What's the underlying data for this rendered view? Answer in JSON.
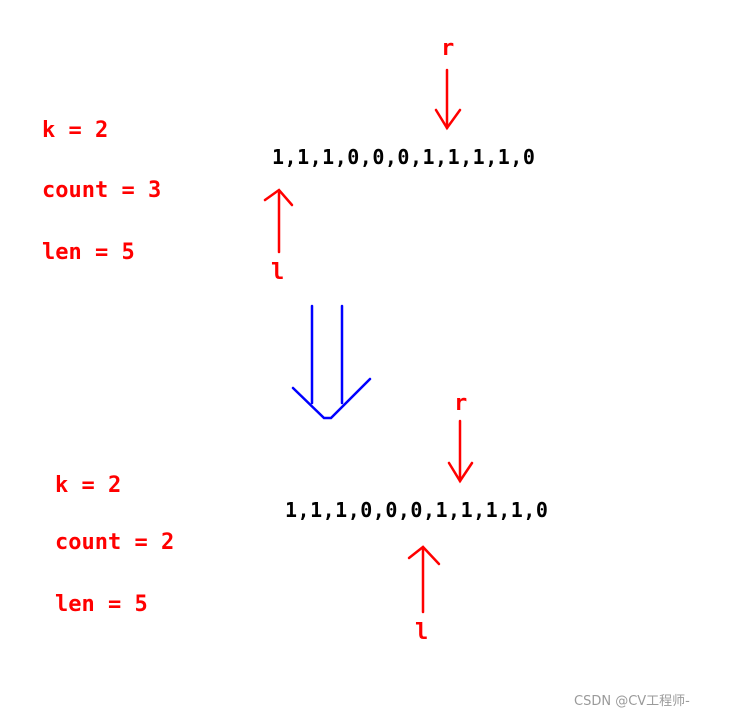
{
  "before": {
    "vars": [
      "k = 2",
      "count = 3",
      "len = 5"
    ],
    "array": "1,1,1,0,0,0,1,1,1,1,0",
    "right_pointer": "r",
    "left_pointer": "l"
  },
  "after": {
    "vars": [
      "k = 2",
      "count = 2",
      "len = 5"
    ],
    "array": "1,1,1,0,0,0,1,1,1,1,0",
    "right_pointer": "r",
    "left_pointer": "l"
  },
  "transition": {
    "icon": "double-down-arrow-icon"
  },
  "colors": {
    "annotation": "#ff0000",
    "array_text": "#000000",
    "transition_arrow": "#0000ff",
    "watermark": "#9a9a9a"
  },
  "watermark": "CSDN @CV工程师-"
}
